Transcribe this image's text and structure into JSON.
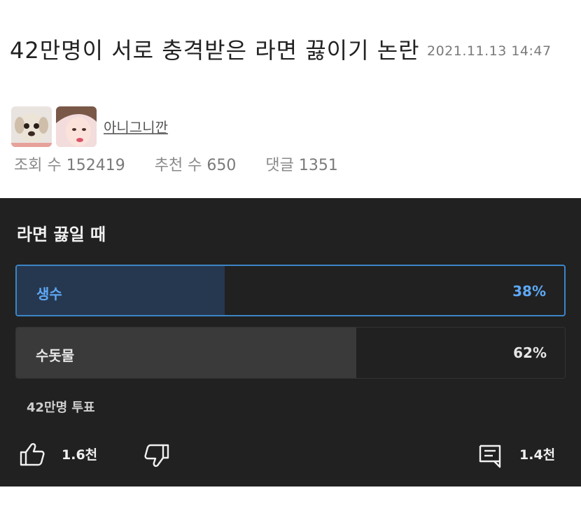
{
  "post": {
    "title": "42만명이 서로 충격받은 라면 끓이기 논란",
    "date": "2021.11.13 14:47",
    "author": "아니그니깐",
    "stats": {
      "views_label": "조회 수",
      "views": "152419",
      "recommends_label": "추천 수",
      "recommends": "650",
      "comments_label": "댓글",
      "comments": "1351"
    }
  },
  "poll": {
    "question": "라면 끓일 때",
    "options": [
      {
        "label": "생수",
        "percent_text": "38%",
        "fraction": 0.38,
        "selected": true
      },
      {
        "label": "수돗물",
        "percent_text": "62%",
        "fraction": 0.62,
        "selected": false
      }
    ],
    "votes": "42만명 투표"
  },
  "actions": {
    "likes": "1.6천",
    "comments": "1.4천"
  },
  "colors": {
    "accent": "#3d85c6",
    "panel_bg": "#212121",
    "selected_text": "#5ea8f5"
  }
}
